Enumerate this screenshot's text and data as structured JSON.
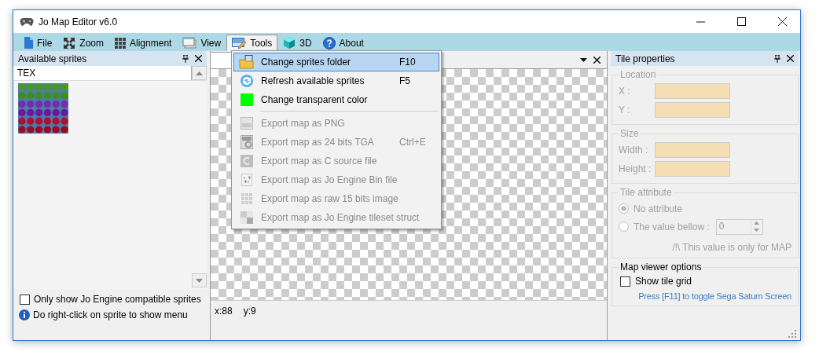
{
  "window": {
    "title": "Jo Map Editor v6.0"
  },
  "menu": [
    {
      "label": "File",
      "selected": false
    },
    {
      "label": "Zoom",
      "selected": false
    },
    {
      "label": "Alignment",
      "selected": false
    },
    {
      "label": "View",
      "selected": false
    },
    {
      "label": "Tools",
      "selected": true
    },
    {
      "label": "3D",
      "selected": false
    },
    {
      "label": "About",
      "selected": false
    }
  ],
  "tools_menu": {
    "items": [
      {
        "kind": "item",
        "label": "Change sprites folder",
        "shortcut": "F10",
        "disabled": false,
        "selected": true
      },
      {
        "kind": "item",
        "label": "Refresh available sprites",
        "shortcut": "F5",
        "disabled": false,
        "selected": false
      },
      {
        "kind": "item",
        "label": "Change transparent color",
        "disabled": false,
        "selected": false
      },
      {
        "kind": "separator"
      },
      {
        "kind": "item",
        "label": "Export map as PNG",
        "disabled": true,
        "selected": false
      },
      {
        "kind": "item",
        "label": "Export map as 24 bits TGA",
        "shortcut": "Ctrl+E",
        "disabled": true,
        "selected": false
      },
      {
        "kind": "item",
        "label": "Export map as C source file",
        "disabled": true,
        "selected": false
      },
      {
        "kind": "item",
        "label": "Export map as Jo Engine Bin file",
        "disabled": true,
        "selected": false
      },
      {
        "kind": "item",
        "label": "Export map as raw 15 bits image",
        "disabled": true,
        "selected": false
      },
      {
        "kind": "item",
        "label": "Export map as Jo Engine tileset struct",
        "disabled": true,
        "selected": false
      }
    ]
  },
  "sprites_panel": {
    "title": "Available sprites",
    "folder": "TEX",
    "compatible_only": {
      "label": "Only show Jo Engine compatible sprites",
      "checked": false
    },
    "hint": "Do right-click on sprite to show menu"
  },
  "map_view": {
    "status": [
      "x:88",
      "y:9"
    ]
  },
  "tile_properties": {
    "title": "Tile properties",
    "location": {
      "title": "Location",
      "fields": [
        {
          "label": "X :"
        },
        {
          "label": "Y :"
        }
      ]
    },
    "size": {
      "title": "Size",
      "fields": [
        {
          "label": "Width :"
        },
        {
          "label": "Height :"
        }
      ]
    },
    "tile_attribute": {
      "title": "Tile attribute",
      "options": [
        {
          "label": "No attribute",
          "selected": true
        },
        {
          "label": "The value bellow :",
          "selected": false
        }
      ],
      "value": "0",
      "note": "/!\\ This value is only for MAP"
    },
    "map_viewer_options": {
      "title": "Map viewer options",
      "show_grid": {
        "label": "Show tile grid",
        "checked": false
      },
      "hint": "Press [F11] to toggle Sega Saturn Screen"
    }
  }
}
